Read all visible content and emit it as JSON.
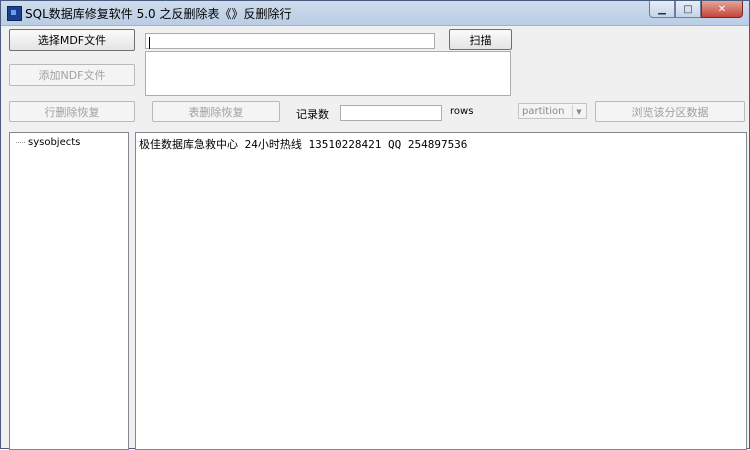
{
  "window": {
    "title": "SQL数据库修复软件 5.0 之反删除表《》反删除行",
    "minimize_glyph": "▁",
    "maximize_glyph": "□",
    "close_glyph": "✕",
    "icon": "app-icon"
  },
  "toolbar": {
    "select_mdf_label": "选择MDF文件",
    "add_ndf_label": "添加NDF文件",
    "scan_label": "扫描",
    "mdf_path_value": "",
    "ndf_list_value": ""
  },
  "recovery": {
    "row_recover_label": "行删除恢复",
    "table_recover_label": "表删除恢复",
    "record_count_label": "记录数",
    "record_count_value": "",
    "rows_label": "rows",
    "partition_value": "partition",
    "browse_partition_label": "浏览该分区数据"
  },
  "tree": {
    "items": [
      {
        "label": "sysobjects"
      }
    ]
  },
  "output": {
    "text": "极佳数据库急救中心 24小时热线 13510228421   QQ 254897536"
  },
  "colors": {
    "titlebar": "#b9cde5",
    "close_button": "#c6443a",
    "disabled_text": "#a0a0a0"
  }
}
